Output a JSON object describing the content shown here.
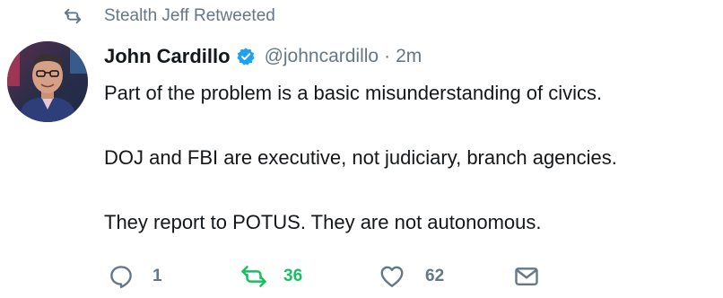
{
  "retweet_context": {
    "text": "Stealth Jeff Retweeted",
    "icon": "retweet-icon"
  },
  "author": {
    "name": "John Cardillo",
    "handle": "@johncardillo",
    "separator": "·",
    "timestamp": "2m",
    "verified": true,
    "verified_color": "#1da1f2"
  },
  "tweet": {
    "paragraphs": [
      "Part of the problem is a basic misunderstanding of civics.",
      "DOJ and FBI are executive, not judiciary, branch agencies.",
      "They report to POTUS. They are not autonomous."
    ]
  },
  "actions": {
    "reply_count": "1",
    "retweet_count": "36",
    "like_count": "62",
    "retweet_active_color": "#17bf63",
    "icon_color": "#657786"
  }
}
